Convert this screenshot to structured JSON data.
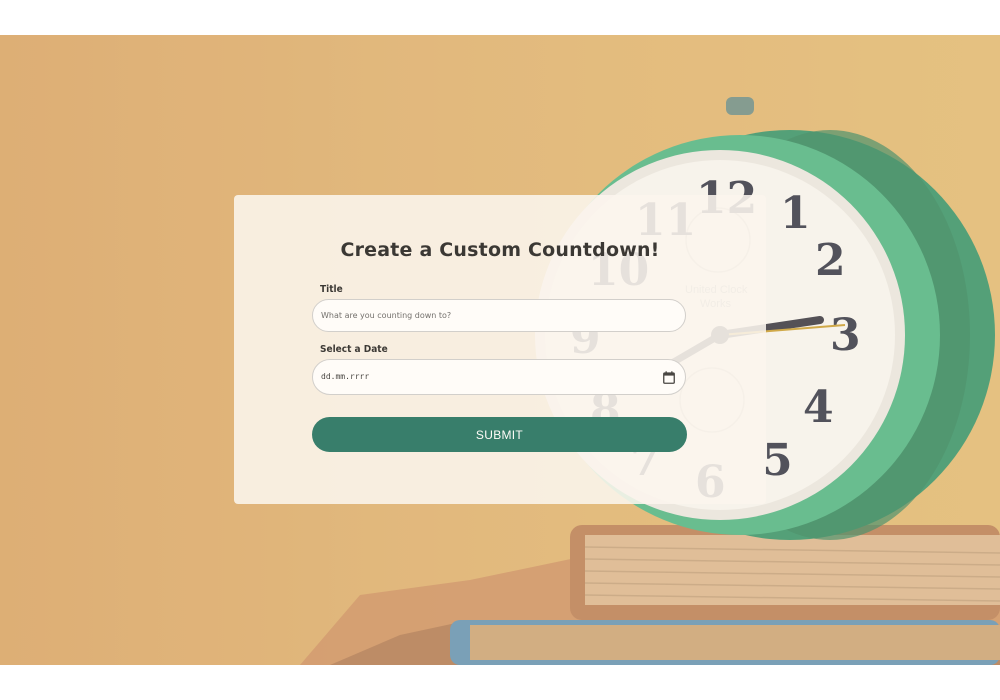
{
  "form": {
    "heading": "Create a Custom Countdown!",
    "title_label": "Title",
    "title_placeholder": "What are you counting down to?",
    "title_value": "",
    "date_label": "Select a Date",
    "date_value": "dd.mm.rrrr",
    "submit_label": "SUBMIT"
  },
  "background": {
    "clock_numerals": [
      "12",
      "1",
      "2",
      "3",
      "4",
      "5",
      "6",
      "7",
      "8",
      "9",
      "10",
      "11"
    ],
    "clock_brand_line1": "United Clock",
    "clock_brand_line2": "Works"
  },
  "colors": {
    "accent": "#0d6654",
    "card": "#faf7f2",
    "background": "#d9a865",
    "clock_frame": "#3aa67a"
  },
  "icons": {
    "date_picker": "calendar-icon"
  }
}
